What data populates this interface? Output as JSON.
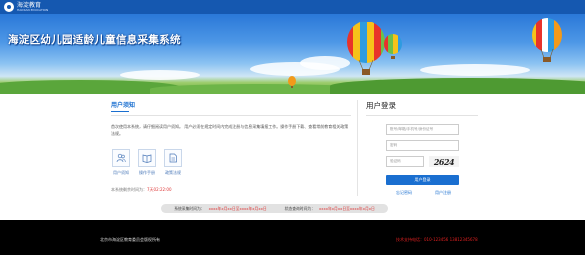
{
  "header": {
    "logo_text": "海淀教育",
    "logo_sub": "HAIDIAN EDUCATION",
    "banner_title": "海淀区幼儿园适龄儿童信息采集系统"
  },
  "notice": {
    "title": "用户须知",
    "text": "首次使用本系统，请仔细阅读用户须知。 用户必须在规定时间内完成注册与信息采集填报工作。操作手册下载、查看常前教育相关政策法规。",
    "tiles": [
      {
        "label": "用户须知",
        "icon": "users-icon"
      },
      {
        "label": "操作手册",
        "icon": "book-icon"
      },
      {
        "label": "政策法规",
        "icon": "document-icon"
      }
    ],
    "countdown_label": "本系统剩余时间为：",
    "countdown_value": "7天02:22:00"
  },
  "login": {
    "title": "用户登录",
    "account_placeholder": "账号/邮箱/手机号/身份证号",
    "password_placeholder": "密码",
    "captcha_placeholder": "验证码",
    "captcha_text": "2624",
    "button_label": "用户登录",
    "forgot_label": "忘记密码",
    "register_label": "用户注册"
  },
  "timebar": {
    "collect_label": "系统采集时间为：",
    "collect_value": "xxxx年x月xx日至xxxx年x月xx日",
    "query_label": "状态查询时间为：",
    "query_value": "xxxx年x月xx日至xxxx年x月x日"
  },
  "footer": {
    "copyright": "北京市海淀区教育委员会版权所有",
    "hotline": "技术支持电话：010-123456  13812345678"
  },
  "colors": {
    "accent": "#1a6fd0",
    "header_bar": "#1558b0",
    "footer_bg": "#000000",
    "alert_red": "#d33333"
  }
}
